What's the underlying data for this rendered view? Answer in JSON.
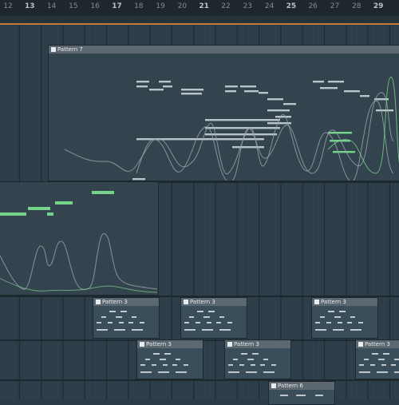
{
  "ruler": {
    "bars": [
      "12",
      "13",
      "14",
      "15",
      "16",
      "17",
      "18",
      "19",
      "20",
      "21",
      "22",
      "23",
      "24",
      "25",
      "26",
      "27",
      "28",
      "29"
    ],
    "major_bars": [
      "13",
      "17",
      "21",
      "25",
      "29"
    ]
  },
  "clips": {
    "pattern7": {
      "name": "Pattern 7"
    },
    "pattern3_a": {
      "name": "Pattern 3"
    },
    "pattern3_b": {
      "name": "Pattern 3"
    },
    "pattern3_c": {
      "name": "Pattern 3"
    },
    "pattern3_d": {
      "name": "Pattern 3"
    },
    "pattern3_e": {
      "name": "Pattern 3"
    },
    "pattern3_f": {
      "name": "Pattern 3"
    },
    "pattern6": {
      "name": "Pattern 6"
    }
  },
  "colors": {
    "note_gray": "#b9c3c8",
    "note_green": "#74d48a",
    "loop_marker": "#c47a3c",
    "clip_header": "#5c6770"
  }
}
